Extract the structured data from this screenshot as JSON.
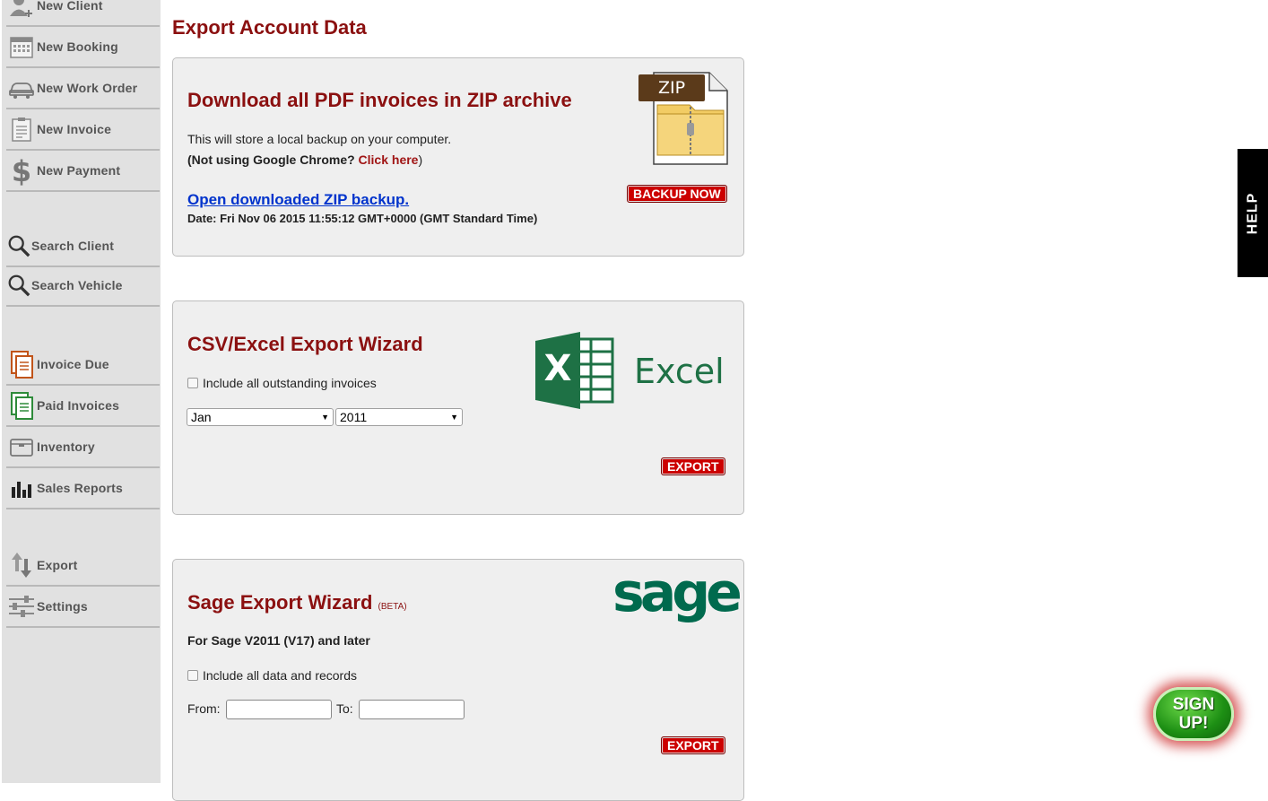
{
  "sidebar": {
    "items": [
      {
        "label": "New Client",
        "icon": "user-plus-icon"
      },
      {
        "label": "New Booking",
        "icon": "calendar-icon"
      },
      {
        "label": "New Work Order",
        "icon": "car-icon"
      },
      {
        "label": "New Invoice",
        "icon": "clipboard-icon"
      },
      {
        "label": "New Payment",
        "icon": "dollar-icon"
      },
      {
        "label": "Search Client",
        "icon": "magnifier-icon"
      },
      {
        "label": "Search Vehicle",
        "icon": "magnifier-icon"
      },
      {
        "label": "Invoice Due",
        "icon": "document-orange-icon"
      },
      {
        "label": "Paid Invoices",
        "icon": "document-green-icon"
      },
      {
        "label": "Inventory",
        "icon": "box-icon"
      },
      {
        "label": "Sales Reports",
        "icon": "bar-chart-icon"
      },
      {
        "label": "Export",
        "icon": "up-down-arrows-icon"
      },
      {
        "label": "Settings",
        "icon": "sliders-icon"
      }
    ]
  },
  "page": {
    "title": "Export Account Data"
  },
  "zip_panel": {
    "title": "Download all PDF invoices in ZIP archive",
    "desc": "This will store a local backup on your computer.",
    "chrome_prefix": "(Not using Google Chrome? ",
    "chrome_link": "Click here",
    "chrome_suffix": ")",
    "open_link": "Open downloaded ZIP backup.",
    "date_text": "Date: Fri Nov 06 2015 11:55:12 GMT+0000 (GMT Standard Time)",
    "zip_label": "ZIP",
    "backup_button": "BACKUP NOW"
  },
  "csv_panel": {
    "title": "CSV/Excel Export Wizard",
    "checkbox_label": "Include all outstanding invoices",
    "month_value": "Jan",
    "year_value": "2011",
    "excel_logo_text": "Excel",
    "excel_x": "X",
    "export_button": "EXPORT"
  },
  "sage_panel": {
    "title": "Sage Export Wizard",
    "beta": "(BETA)",
    "subtitle": "For Sage V2011 (V17) and later",
    "checkbox_label": "Include all data and records",
    "from_label": "From:",
    "to_label": "To:",
    "logo_text": "sage",
    "export_button": "EXPORT"
  },
  "help_tab": {
    "label": "HELP"
  },
  "signup": {
    "line1": "SIGN",
    "line2": "UP!"
  },
  "colors": {
    "accent_red": "#8b1010",
    "button_red": "#cc0000",
    "link_blue": "#0033cc",
    "excel_green": "#1e7145",
    "sage_green": "#006a4e"
  }
}
